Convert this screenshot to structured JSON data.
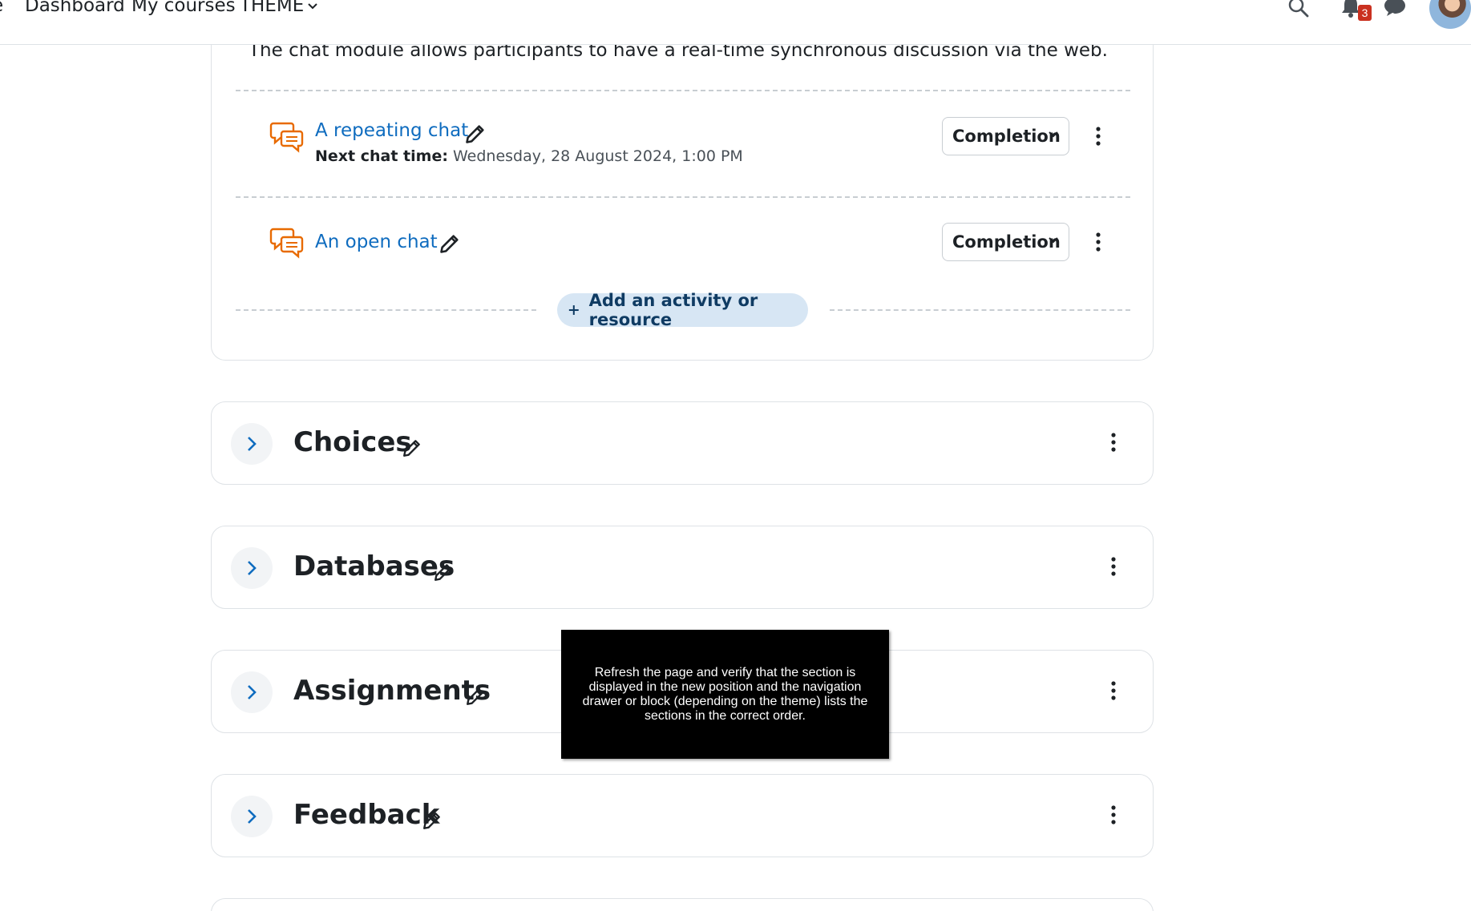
{
  "navbar": {
    "cut_item": "e",
    "dashboard": "Dashboard",
    "my_courses": "My courses",
    "theme": "THEME",
    "notification_count": "3",
    "icons": [
      "search-icon",
      "bell-icon",
      "chat-icon",
      "avatar"
    ]
  },
  "section_top": {
    "summary": "The chat module allows participants to have a real-time synchronous discussion via the web.",
    "activities": [
      {
        "name": "A repeating chat",
        "info_label": "Next chat time:",
        "info_value": "Wednesday, 28 August 2024, 1:00 PM",
        "completion": "Completion",
        "icon": "chat-activity-icon"
      },
      {
        "name": "An open chat",
        "completion": "Completion",
        "icon": "chat-activity-icon"
      }
    ],
    "add_button": "Add an activity or resource"
  },
  "sections": [
    {
      "title": "Choices"
    },
    {
      "title": "Databases"
    },
    {
      "title": "Assignments"
    },
    {
      "title": "Feedback"
    }
  ],
  "note": {
    "text": "Refresh the page and verify that the section is displayed in the new position and the navigation drawer or block (depending on the theme) lists the sections in the correct order."
  },
  "colors": {
    "link": "#0f6cbf",
    "activity_icon": "#e86a00",
    "add_button_bg": "#d7e6f4",
    "badge": "#ca3120"
  }
}
